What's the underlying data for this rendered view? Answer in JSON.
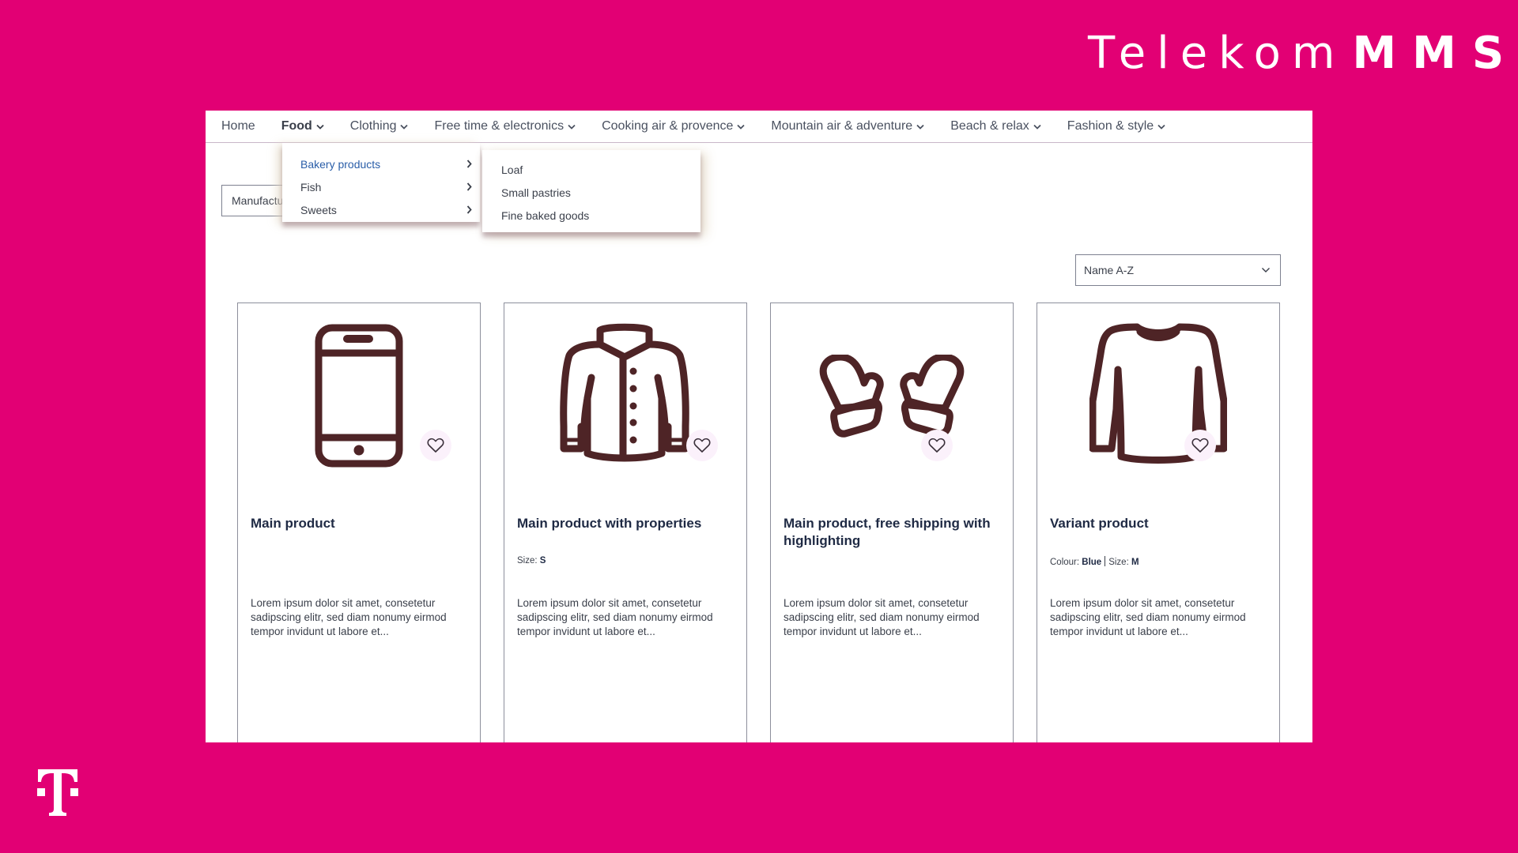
{
  "brand": {
    "name": "Telekom",
    "suffix": "MMS"
  },
  "colors": {
    "background": "#e20074",
    "icon_stroke": "#4e2426",
    "link_hover": "#2a5ea8"
  },
  "nav": {
    "items": [
      {
        "label": "Home",
        "has_dropdown": false,
        "active": false
      },
      {
        "label": "Food",
        "has_dropdown": true,
        "active": true
      },
      {
        "label": "Clothing",
        "has_dropdown": true,
        "active": false
      },
      {
        "label": "Free time & electronics",
        "has_dropdown": true,
        "active": false
      },
      {
        "label": "Cooking air & provence",
        "has_dropdown": true,
        "active": false
      },
      {
        "label": "Mountain air & adventure",
        "has_dropdown": true,
        "active": false
      },
      {
        "label": "Beach & relax",
        "has_dropdown": true,
        "active": false
      },
      {
        "label": "Fashion & style",
        "has_dropdown": true,
        "active": false
      }
    ]
  },
  "food_menu": {
    "items": [
      {
        "label": "Bakery products",
        "hovered": true
      },
      {
        "label": "Fish",
        "hovered": false
      },
      {
        "label": "Sweets",
        "hovered": false
      }
    ],
    "submenu": [
      "Loaf",
      "Small pastries",
      "Fine baked goods"
    ]
  },
  "filter": {
    "label": "Manufacturer"
  },
  "sort": {
    "selected": "Name A-Z"
  },
  "products": [
    {
      "image_icon": "smartphone-icon",
      "title": "Main product",
      "properties": [],
      "description": "Lorem ipsum dolor sit amet, consetetur sadipscing elitr, sed diam nonumy eirmod tempor invidunt ut labore et..."
    },
    {
      "image_icon": "jacket-icon",
      "title": "Main product with properties",
      "properties": [
        {
          "name": "Size:",
          "value": "S"
        }
      ],
      "description": "Lorem ipsum dolor sit amet, consetetur sadipscing elitr, sed diam nonumy eirmod tempor invidunt ut labore et..."
    },
    {
      "image_icon": "mittens-icon",
      "title": "Main product, free shipping with highlighting",
      "properties": [],
      "description": "Lorem ipsum dolor sit amet, consetetur sadipscing elitr, sed diam nonumy eirmod tempor invidunt ut labore et..."
    },
    {
      "image_icon": "sweater-icon",
      "title": "Variant product",
      "properties": [
        {
          "name": "Colour:",
          "value": "Blue"
        },
        {
          "name": "Size:",
          "value": "M"
        }
      ],
      "description": "Lorem ipsum dolor sit amet, consetetur sadipscing elitr, sed diam nonumy eirmod tempor invidunt ut labore et..."
    }
  ]
}
